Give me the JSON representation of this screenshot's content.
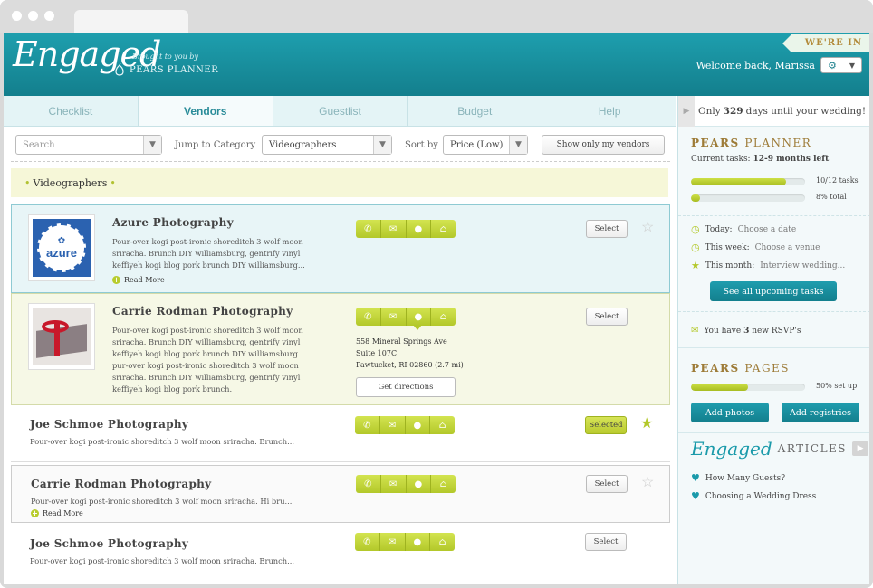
{
  "header": {
    "logo_text": "Engaged",
    "brought_by": "Brought to you by",
    "pears_brand": "PEARS PLANNER",
    "beta": "WE'RE IN BETA",
    "welcome": "Welcome back, Marissa"
  },
  "nav": {
    "tabs": [
      "Checklist",
      "Vendors",
      "Guestlist",
      "Budget",
      "Help"
    ],
    "active": "Vendors"
  },
  "filters": {
    "search_placeholder": "Search",
    "jump_label": "Jump to Category",
    "category_value": "Videographers",
    "sort_label": "Sort by",
    "sort_value": "Price (Low)",
    "show_mine": "Show only my vendors"
  },
  "category_title": "Videographers",
  "vendors": [
    {
      "name": "Azure Photography",
      "desc": [
        "Pour-over kogi post-ironic shoreditch 3 wolf moon",
        "sriracha. Brunch DIY williamsburg, gentrify vinyl",
        "keffiyeh kogi blog pork brunch DIY williamsburg..."
      ],
      "read_more": "Read More",
      "select": "Select",
      "logo_text": "azure"
    },
    {
      "name": "Carrie Rodman Photography",
      "desc": [
        "Pour-over kogi post-ironic shoreditch 3 wolf moon",
        "sriracha. Brunch DIY williamsburg, gentrify vinyl",
        "keffiyeh kogi blog pork brunch DIY williamsburg",
        "pur-over kogi post-ironic shoreditch 3 wolf moon",
        "sriracha. Brunch DIY williamsburg, gentrify vinyl",
        "keffiyeh kogi blog pork brunch."
      ],
      "address": [
        "558 Mineral Springs Ave",
        "Suite 107C",
        "Pawtucket, RI 02860 (2.7 mi)"
      ],
      "directions": "Get directions",
      "select": "Select"
    },
    {
      "name": "Joe Schmoe Photography",
      "desc": [
        "Pour-over kogi post-ironic shoreditch 3 wolf moon sriracha. Brunch..."
      ],
      "select": "Selected"
    },
    {
      "name": "Carrie Rodman Photography",
      "desc": [
        "Pour-over kogi post-ironic shoreditch 3 wolf moon sriracha. Hi bru..."
      ],
      "read_more": "Read More",
      "select": "Select"
    },
    {
      "name": "Joe Schmoe Photography",
      "desc": [
        "Pour-over kogi post-ironic shoreditch 3 wolf moon sriracha. Brunch..."
      ],
      "select": "Select"
    }
  ],
  "sidebar": {
    "countdown_pre": "Only ",
    "countdown_days": "329",
    "countdown_post": " days until your wedding!",
    "planner_title_a": "PEARS",
    "planner_title_b": "PLANNER",
    "current_tasks_label": "Current tasks: ",
    "current_tasks_value": "12-9 months left",
    "tasks_bar_label": "10/12 tasks",
    "tasks_fraction": 0.83,
    "total_bar_label": "8% total",
    "total_fraction": 0.08,
    "today_label": "Today:",
    "today_value": "Choose a date",
    "week_label": "This week:",
    "week_value": "Choose a venue",
    "month_label": "This month:",
    "month_value": "Interview wedding...",
    "upcoming_btn": "See all upcoming tasks",
    "rsvp_pre": "You have ",
    "rsvp_count": "3",
    "rsvp_post": " new RSVP's",
    "pages_title_a": "PEARS",
    "pages_title_b": "PAGES",
    "pages_label": "50% set up",
    "pages_fraction": 0.5,
    "add_photos": "Add photos",
    "add_registries": "Add registries",
    "articles_logo": "Engaged",
    "articles_title": "ARTICLES",
    "articles": [
      "How Many Guests?",
      "Choosing a Wedding Dress"
    ]
  },
  "colors": {
    "teal": "#1a8f9e",
    "lime": "#b9cc2e",
    "gold": "#9d7b37"
  }
}
